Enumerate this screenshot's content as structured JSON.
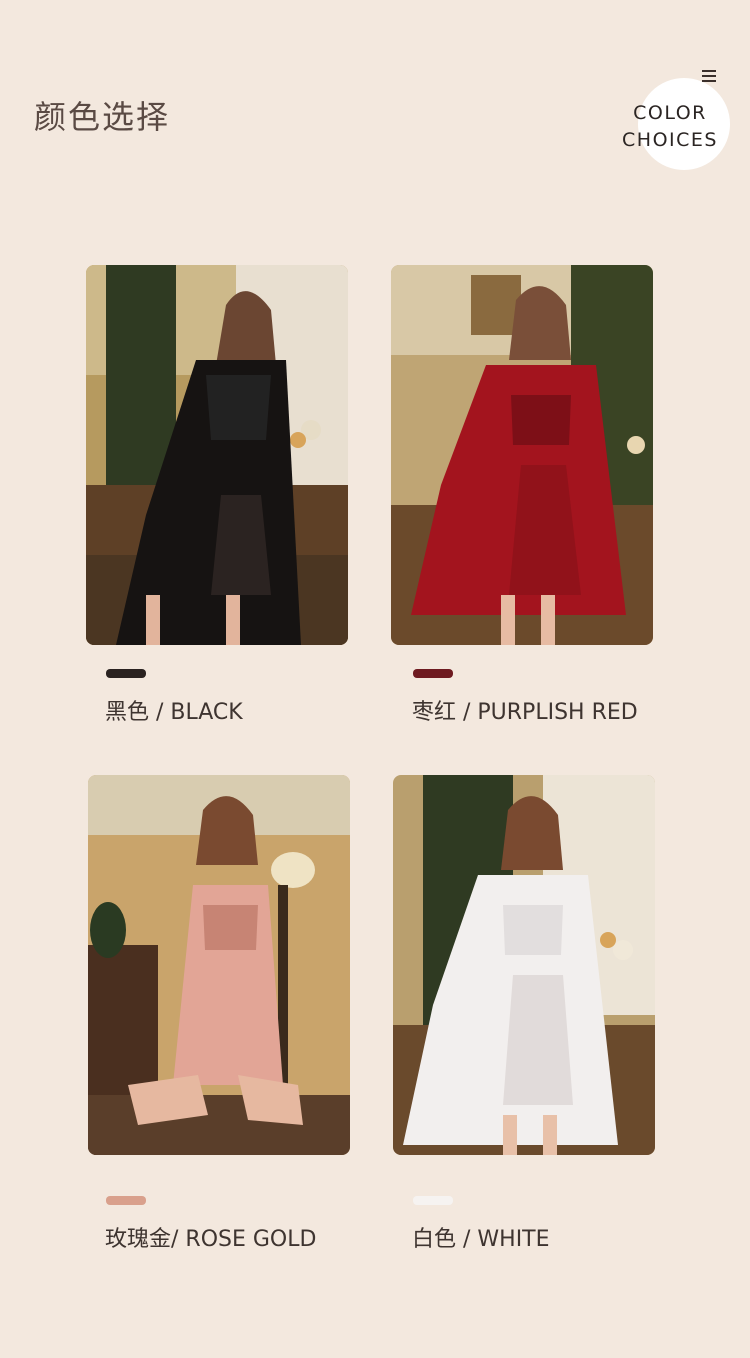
{
  "header": {
    "title": "颜色选择",
    "badge_line1": "COLOR",
    "badge_line2": "CHOICES"
  },
  "icons": {
    "menu": "hamburger-menu-icon"
  },
  "colors": [
    {
      "label": "黑色 / BLACK",
      "swatch": "#2a2220"
    },
    {
      "label": "枣红 / PURPLISH RED",
      "swatch": "#6e1a20"
    },
    {
      "label": "玫瑰金/ ROSE GOLD",
      "swatch": "#d9a08c"
    },
    {
      "label": "白色 / WHITE",
      "swatch": "#f6f3f1"
    }
  ]
}
